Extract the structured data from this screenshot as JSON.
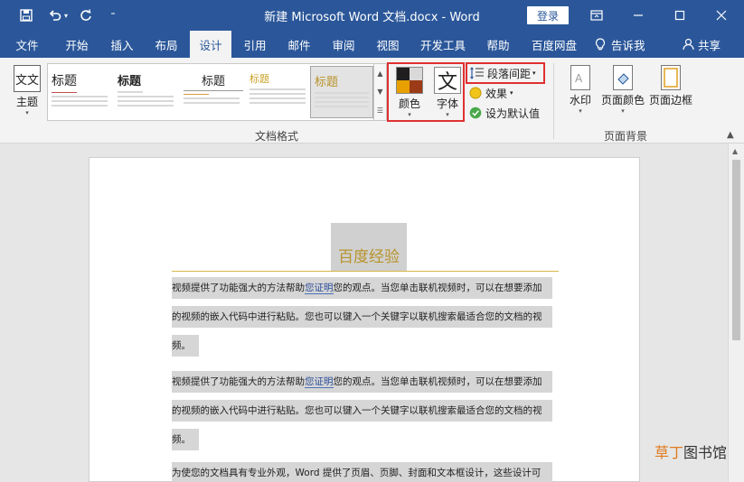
{
  "titlebar": {
    "doc_title": "新建 Microsoft Word 文档.docx  -  Word",
    "login_label": "登录"
  },
  "menubar": {
    "tabs": [
      {
        "label": "文件"
      },
      {
        "label": "开始"
      },
      {
        "label": "插入"
      },
      {
        "label": "布局"
      },
      {
        "label": "设计"
      },
      {
        "label": "引用"
      },
      {
        "label": "邮件"
      },
      {
        "label": "审阅"
      },
      {
        "label": "视图"
      },
      {
        "label": "开发工具"
      },
      {
        "label": "帮助"
      },
      {
        "label": "百度网盘"
      }
    ],
    "tell_me": "告诉我",
    "share": "共享"
  },
  "ribbon": {
    "theme_label": "主题",
    "theme_icon_text": "文文",
    "styles": [
      {
        "title": "标题"
      },
      {
        "title": "标题"
      },
      {
        "title": "标题"
      },
      {
        "title": "标题"
      },
      {
        "title": "标题"
      }
    ],
    "color_label": "颜色",
    "font_label": "字体",
    "font_glyph": "文",
    "spacing_label": "段落间距",
    "effects_label": "效果",
    "default_label": "设为默认值",
    "doc_format_label": "文档格式",
    "watermark_label": "水印",
    "page_color_label": "页面颜色",
    "page_border_label": "页面边框",
    "page_bg_label": "页面背景",
    "colors": {
      "accent": "#2b579a",
      "swatch_1": "#1f1f1f",
      "swatch_2": "#d9d9d9",
      "swatch_3": "#e8a000",
      "swatch_4": "#9c3b17",
      "heading": "#b8932a"
    }
  },
  "document": {
    "heading": "百度经验",
    "lines": [
      {
        "pre": "视频提供了功能强大的方法帮助",
        "u": "您证明",
        "post": "您的观点。当您单击联机视频时，可以在想要添加"
      },
      {
        "pre": "的视频的嵌入代码中进行粘贴。您也可以键入一个关键字以联机搜索最适合您的文档的视",
        "u": "",
        "post": ""
      },
      {
        "pre": "频。",
        "u": "",
        "post": ""
      },
      {
        "pre": "视频提供了功能强大的方法帮助",
        "u": "您证明",
        "post": "您的观点。当您单击联机视频时，可以在想要添加"
      },
      {
        "pre": "的视频的嵌入代码中进行粘贴。您也可以键入一个关键字以联机搜索最适合您的文档的视",
        "u": "",
        "post": ""
      },
      {
        "pre": "频。",
        "u": "",
        "post": ""
      },
      {
        "pre": "为使您的文档具有专业外观，Word 提供了页眉、页脚、封面和文本框设计，这些设计可",
        "u": "",
        "post": ""
      }
    ]
  },
  "watermark": {
    "orange": "草丁",
    "black": "图书馆"
  }
}
